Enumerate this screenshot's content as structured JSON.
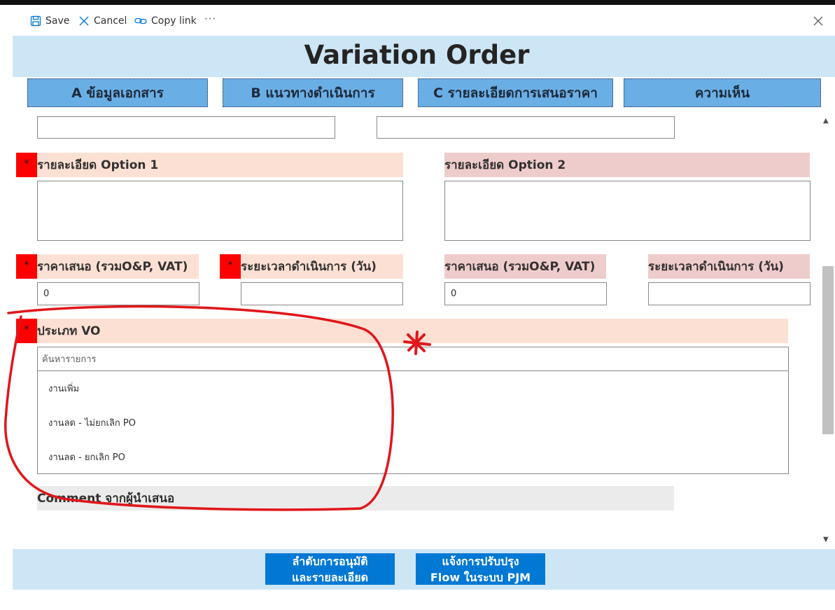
{
  "commands": {
    "save": "Save",
    "cancel": "Cancel",
    "copy_link": "Copy link",
    "more": "···"
  },
  "header": {
    "title": "Variation Order"
  },
  "tabs": [
    {
      "label": "A ข้อมูลเอกสาร"
    },
    {
      "label": "B แนวทางดำเนินการ"
    },
    {
      "label": "C รายละเอียดการเสนอราคา"
    },
    {
      "label": "ความเห็น"
    }
  ],
  "form": {
    "option1_detail_label": "รายละเอียด Option 1",
    "option2_detail_label": "รายละเอียด Option 2",
    "option1_price_label": "ราคาเสนอ (รวมO&P, VAT)",
    "option1_duration_label": "ระยะเวลาดำเนินการ (วัน)",
    "option2_price_label": "ราคาเสนอ (รวมO&P, VAT)",
    "option2_duration_label": "ระยะเวลาดำเนินการ (วัน)",
    "option1_price_value": "0",
    "option2_price_value": "0",
    "required_mark": "*",
    "vo_type_label": "ประเภท VO",
    "vo_search_placeholder": "ค้นหารายการ",
    "vo_options": [
      "งานเพิ่ม",
      "งานลด - ไม่ยกเลิก PO",
      "งานลด - ยกเลิก PO"
    ],
    "comment_label": "Comment จากผู้นำเสนอ"
  },
  "footer": {
    "approval_button_line1": "ลำดับการอนุมัติ",
    "approval_button_line2": "และรายละเอียด",
    "flow_button_line1": "แจ้งการปรับปรุง",
    "flow_button_line2": "Flow ในระบบ PJM"
  },
  "colors": {
    "banner": "#cde6f6",
    "tab": "#6aaee6",
    "label_peach": "#fde0d4",
    "label_pink": "#efcccc",
    "required": "#ff0000",
    "primary_button": "#0078d4",
    "annotation": "#e0161b"
  }
}
